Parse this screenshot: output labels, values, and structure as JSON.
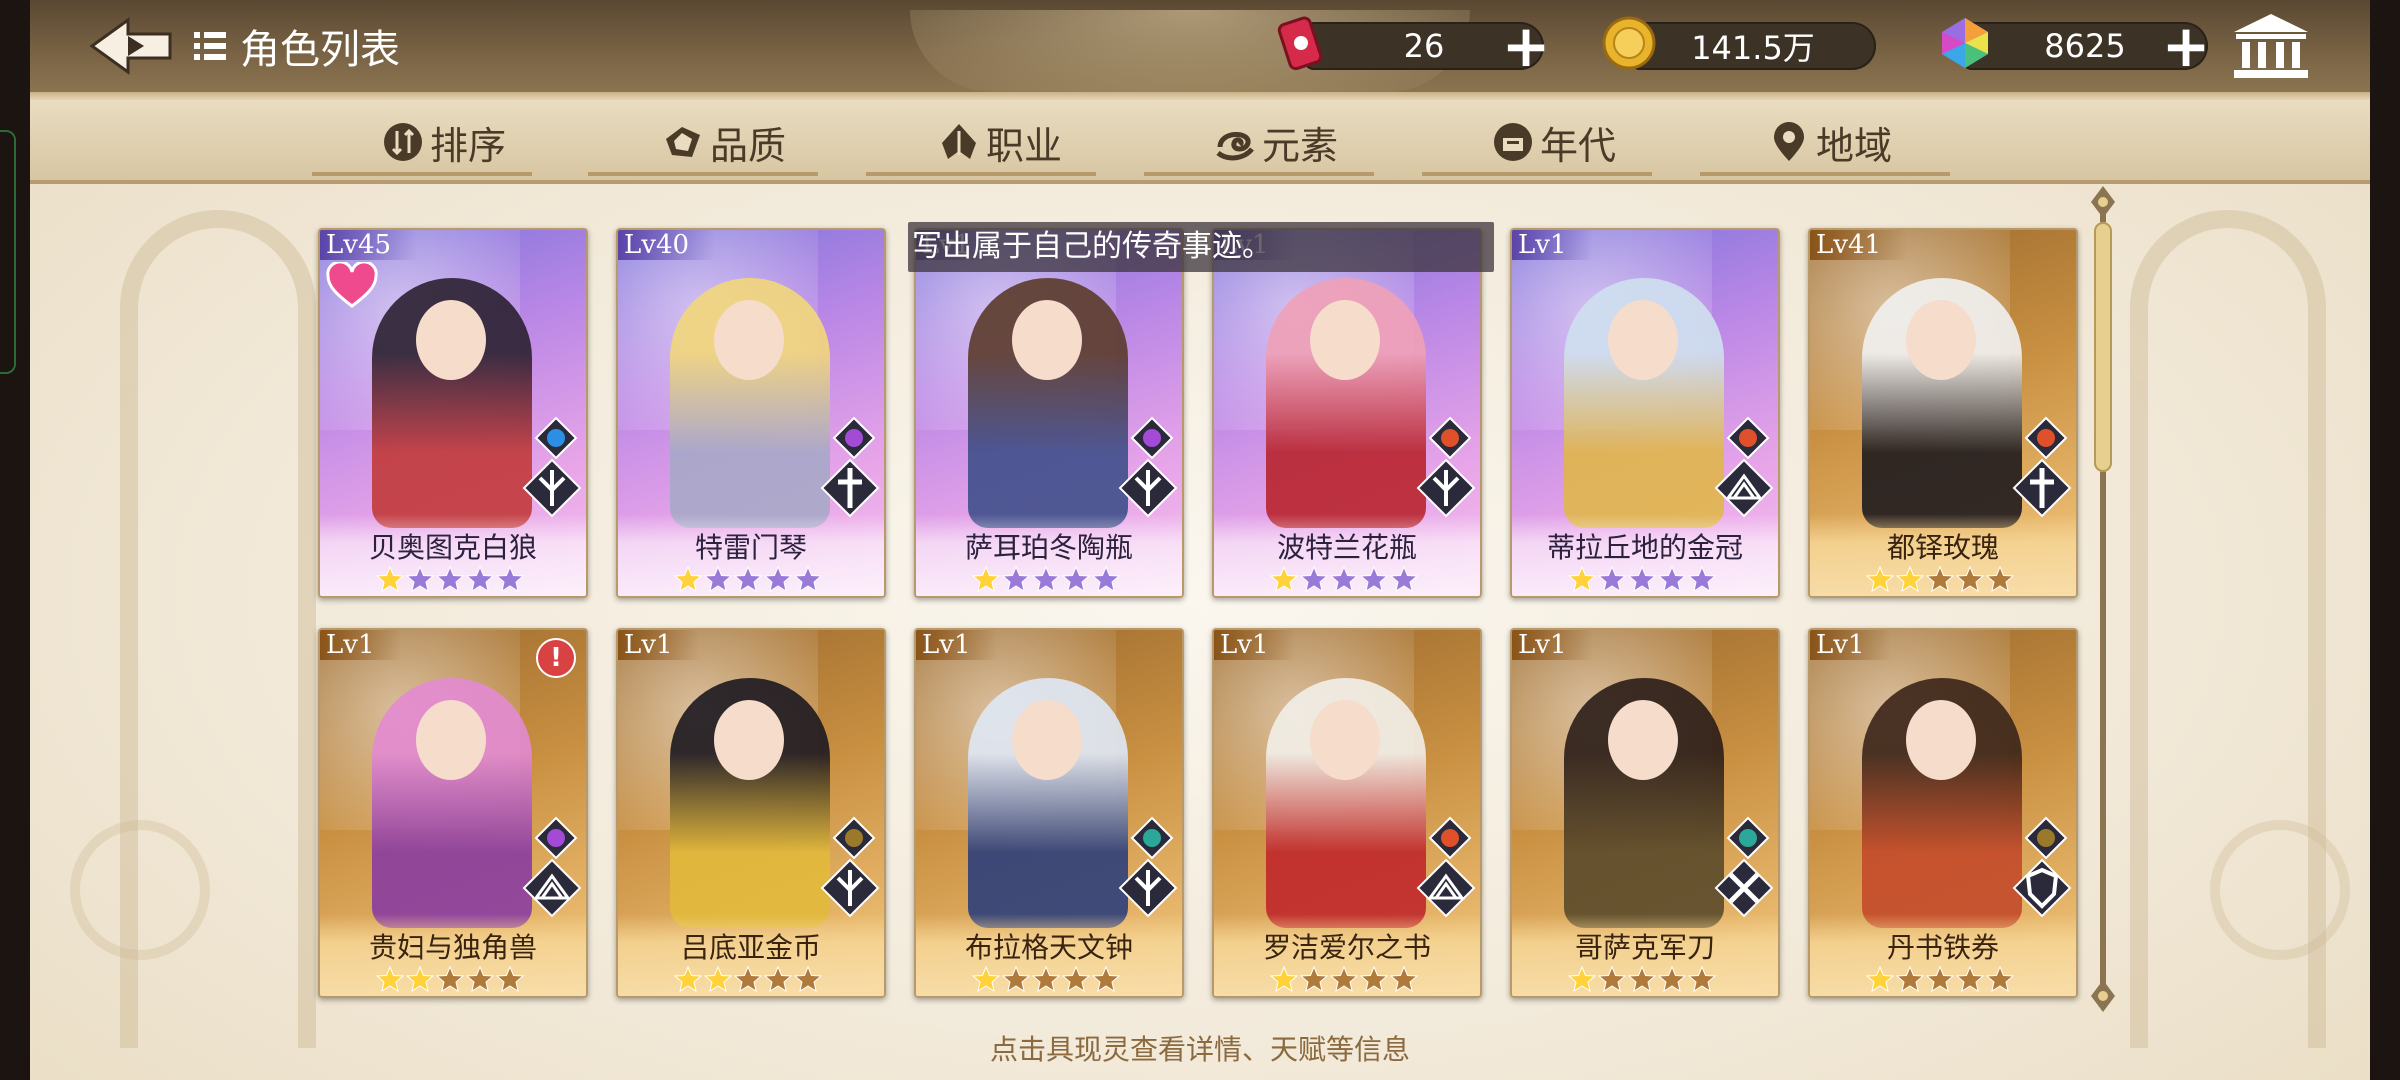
{
  "header": {
    "title": "角色列表",
    "resources": [
      {
        "name": "stamina",
        "value": "26",
        "icon": "red-can-icon"
      },
      {
        "name": "gold",
        "value": "141.5万",
        "icon": "gold-coin-icon"
      },
      {
        "name": "gem",
        "value": "8625",
        "icon": "rainbow-gem-icon"
      }
    ]
  },
  "filters": [
    {
      "label": "排序",
      "icon": "sort-icon"
    },
    {
      "label": "品质",
      "icon": "quality-icon"
    },
    {
      "label": "职业",
      "icon": "class-icon"
    },
    {
      "label": "元素",
      "icon": "element-icon"
    },
    {
      "label": "年代",
      "icon": "era-icon"
    },
    {
      "label": "地域",
      "icon": "region-icon"
    }
  ],
  "tooltip": "写出属于自己的传奇事迹。",
  "hint": "点击具现灵查看详情、天赋等信息",
  "cards": [
    {
      "level": "Lv45",
      "name": "贝奥图克白狼",
      "stars": 1,
      "rarity": "purple",
      "element": "water",
      "class": "tri-blade",
      "favorite": true,
      "colors": [
        "#2a2030",
        "#c23a3a"
      ]
    },
    {
      "level": "Lv40",
      "name": "特雷门琴",
      "stars": 1,
      "rarity": "purple",
      "element": "lightning",
      "class": "cross-staff",
      "colors": [
        "#f2d77a",
        "#a7a8c8"
      ]
    },
    {
      "level": "Lv1",
      "name": "萨耳珀冬陶瓶",
      "stars": 1,
      "rarity": "purple",
      "element": "lightning",
      "class": "tri-blade",
      "colors": [
        "#5a3a2a",
        "#3f4f8a"
      ]
    },
    {
      "level": "Lv1",
      "name": "波特兰花瓶",
      "stars": 1,
      "rarity": "purple",
      "element": "fire",
      "class": "tri-blade",
      "colors": [
        "#f0a0b6",
        "#b8242e"
      ]
    },
    {
      "level": "Lv1",
      "name": "蒂拉丘地的金冠",
      "stars": 1,
      "rarity": "purple",
      "element": "fire",
      "class": "book",
      "colors": [
        "#cfe0ef",
        "#e0b64a"
      ]
    },
    {
      "level": "Lv41",
      "name": "都铎玫瑰",
      "stars": 2,
      "rarity": "gold",
      "element": "fire",
      "class": "cross-staff",
      "colors": [
        "#f1f1f1",
        "#1e1a1e"
      ]
    },
    {
      "level": "Lv1",
      "name": "贵妇与独角兽",
      "stars": 2,
      "rarity": "gold",
      "element": "lightning",
      "class": "book",
      "alert": true,
      "colors": [
        "#e38ad2",
        "#8a3ca0"
      ]
    },
    {
      "level": "Lv1",
      "name": "吕底亚金币",
      "stars": 2,
      "rarity": "gold",
      "element": "earth",
      "class": "tri-blade",
      "colors": [
        "#1c1820",
        "#e2b93a"
      ]
    },
    {
      "level": "Lv1",
      "name": "布拉格天文钟",
      "stars": 1,
      "rarity": "gold",
      "element": "wind",
      "class": "tri-blade",
      "colors": [
        "#dfe8f6",
        "#2e3f7a"
      ]
    },
    {
      "level": "Lv1",
      "name": "罗洁爱尔之书",
      "stars": 1,
      "rarity": "gold",
      "element": "fire",
      "class": "book",
      "colors": [
        "#f2efe9",
        "#c0262a"
      ]
    },
    {
      "level": "Lv1",
      "name": "哥萨克军刀",
      "stars": 1,
      "rarity": "gold",
      "element": "wind",
      "class": "crossed-swords",
      "colors": [
        "#2a1c18",
        "#5a4a2a"
      ]
    },
    {
      "level": "Lv1",
      "name": "丹书铁券",
      "stars": 1,
      "rarity": "gold",
      "element": "earth",
      "class": "shield",
      "colors": [
        "#3a2418",
        "#c44a2a"
      ]
    }
  ]
}
